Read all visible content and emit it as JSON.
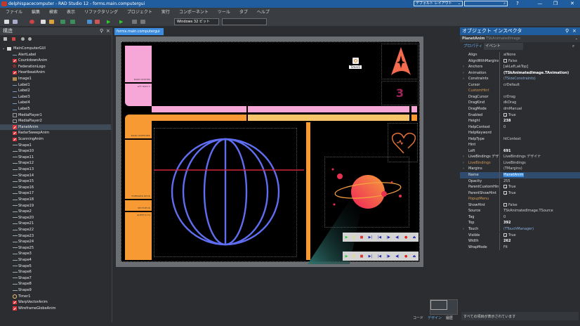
{
  "window": {
    "title": "delphispacecomputer - RAD Studio 12 - forms.main.computergui",
    "layout": "デフォルト レイアウト",
    "controls": [
      "?",
      "—",
      "❐",
      "✕"
    ]
  },
  "menu": [
    "ファイル",
    "編集",
    "検索",
    "表示",
    "リファクタリング",
    "プロジェクト",
    "実行",
    "コンポーネント",
    "ツール",
    "タブ",
    "ヘルプ"
  ],
  "toolbar": {
    "platform": "Windows 32 ビット",
    "config": ""
  },
  "structure": {
    "title": "構造",
    "root": "MainComputerGUI",
    "items": [
      {
        "name": "AlertLabel",
        "icon": "label"
      },
      {
        "name": "CountdownAnim",
        "icon": "anim"
      },
      {
        "name": "FederationLogo",
        "icon": "logo"
      },
      {
        "name": "HeartbeatAnim",
        "icon": "anim"
      },
      {
        "name": "Image1",
        "icon": "img"
      },
      {
        "name": "Label1",
        "icon": "label"
      },
      {
        "name": "Label2",
        "icon": "label"
      },
      {
        "name": "Label3",
        "icon": "label"
      },
      {
        "name": "Label4",
        "icon": "label"
      },
      {
        "name": "Label5",
        "icon": "label"
      },
      {
        "name": "MediaPlayer1",
        "icon": "media"
      },
      {
        "name": "MediaPlayer2",
        "icon": "media"
      },
      {
        "name": "PlanetAnim",
        "icon": "anim",
        "selected": true
      },
      {
        "name": "RadarSweepAnim",
        "icon": "anim"
      },
      {
        "name": "ScanningAnim",
        "icon": "anim"
      },
      {
        "name": "Shape1",
        "icon": "shape"
      },
      {
        "name": "Shape10",
        "icon": "shape"
      },
      {
        "name": "Shape11",
        "icon": "shape"
      },
      {
        "name": "Shape12",
        "icon": "shape"
      },
      {
        "name": "Shape13",
        "icon": "shape"
      },
      {
        "name": "Shape14",
        "icon": "shape"
      },
      {
        "name": "Shape15",
        "icon": "shape"
      },
      {
        "name": "Shape16",
        "icon": "shape"
      },
      {
        "name": "Shape17",
        "icon": "shape"
      },
      {
        "name": "Shape18",
        "icon": "shape"
      },
      {
        "name": "Shape19",
        "icon": "shape"
      },
      {
        "name": "Shape2",
        "icon": "shape"
      },
      {
        "name": "Shape20",
        "icon": "shape"
      },
      {
        "name": "Shape21",
        "icon": "shape"
      },
      {
        "name": "Shape22",
        "icon": "shape"
      },
      {
        "name": "Shape23",
        "icon": "shape"
      },
      {
        "name": "Shape24",
        "icon": "shape"
      },
      {
        "name": "Shape25",
        "icon": "shape"
      },
      {
        "name": "Shape3",
        "icon": "shape"
      },
      {
        "name": "Shape4",
        "icon": "shape"
      },
      {
        "name": "Shape5",
        "icon": "shape"
      },
      {
        "name": "Shape6",
        "icon": "shape"
      },
      {
        "name": "Shape7",
        "icon": "shape"
      },
      {
        "name": "Shape8",
        "icon": "shape"
      },
      {
        "name": "Shape9",
        "icon": "shape"
      },
      {
        "name": "Timer1",
        "icon": "timer"
      },
      {
        "name": "WarpVectorAnim",
        "icon": "anim"
      },
      {
        "name": "WireframeGlobeAnim",
        "icon": "anim"
      }
    ]
  },
  "designer": {
    "tab": "forms.main.computergui",
    "timer_label": "Timer1",
    "countdown": "3",
    "lcars_labels": [
      "MAIN SYSTEM",
      "47T 302D C",
      "MAIN OVERVIEW",
      "FORWARD DECK",
      "SECTOR 09",
      "ALERT 0174"
    ],
    "bottom_tabs": [
      "コード",
      "デザイン",
      "履歴"
    ],
    "colors": {
      "pink": "#f7a6d8",
      "orange": "#f79a33",
      "gold": "#f7c56a",
      "globe": "#5f6ef0",
      "scanline": "#d0243a",
      "logo": "#f36b4f"
    }
  },
  "inspector": {
    "title": "オブジェクト インスペクタ",
    "component": "PlanetAnim",
    "component_type": "TSkAnimatedImage",
    "tabs": [
      "プロパティ",
      "イベント"
    ],
    "properties": [
      {
        "k": "Align",
        "v": "alNone"
      },
      {
        "k": "AlignWithMargins",
        "v": "False",
        "cb": false
      },
      {
        "k": "Anchors",
        "v": "[akLeft,akTop]",
        "exp": true
      },
      {
        "k": "Animation",
        "v": "(TSkAnimatedImage.TAnimation)",
        "exp": true,
        "bold": true
      },
      {
        "k": "Constraints",
        "v": "(TSizeConstraints)",
        "exp": true,
        "blue": true
      },
      {
        "k": "Cursor",
        "v": "crDefault"
      },
      {
        "k": "CustomHint",
        "v": "",
        "ref": true
      },
      {
        "k": "DragCursor",
        "v": "crDrag"
      },
      {
        "k": "DragKind",
        "v": "dkDrag"
      },
      {
        "k": "DragMode",
        "v": "dmManual"
      },
      {
        "k": "Enabled",
        "v": "True",
        "cb": true
      },
      {
        "k": "Height",
        "v": "238",
        "bold": true
      },
      {
        "k": "HelpContext",
        "v": "0"
      },
      {
        "k": "HelpKeyword",
        "v": ""
      },
      {
        "k": "HelpType",
        "v": "htContext"
      },
      {
        "k": "Hint",
        "v": ""
      },
      {
        "k": "Left",
        "v": "691",
        "bold": true
      },
      {
        "k": "LiveBindings デザイナ",
        "v": "LiveBindings デザイナ",
        "exp": true
      },
      {
        "k": "LiveBindings",
        "v": "LiveBindings",
        "exp": true,
        "ref": true
      },
      {
        "k": "Margins",
        "v": "(TMargins)",
        "exp": true
      },
      {
        "k": "Name",
        "v": "PlanetAnim",
        "selected": true
      },
      {
        "k": "Opacity",
        "v": "255"
      },
      {
        "k": "ParentCustomHint",
        "v": "True",
        "cb": true
      },
      {
        "k": "ParentShowHint",
        "v": "True",
        "cb": true
      },
      {
        "k": "PopupMenu",
        "v": "",
        "ref": true
      },
      {
        "k": "ShowHint",
        "v": "False",
        "cb": false
      },
      {
        "k": "Source",
        "v": "TSkAnimatedImage.TSource"
      },
      {
        "k": "Tag",
        "v": "0"
      },
      {
        "k": "Top",
        "v": "392",
        "bold": true
      },
      {
        "k": "Touch",
        "v": "(TTouchManager)",
        "exp": true,
        "blue": true
      },
      {
        "k": "Visible",
        "v": "True",
        "cb": true
      },
      {
        "k": "Width",
        "v": "262",
        "bold": true
      },
      {
        "k": "WrapMode",
        "v": "Fit"
      }
    ],
    "status": "すべての項目が表示されています"
  }
}
